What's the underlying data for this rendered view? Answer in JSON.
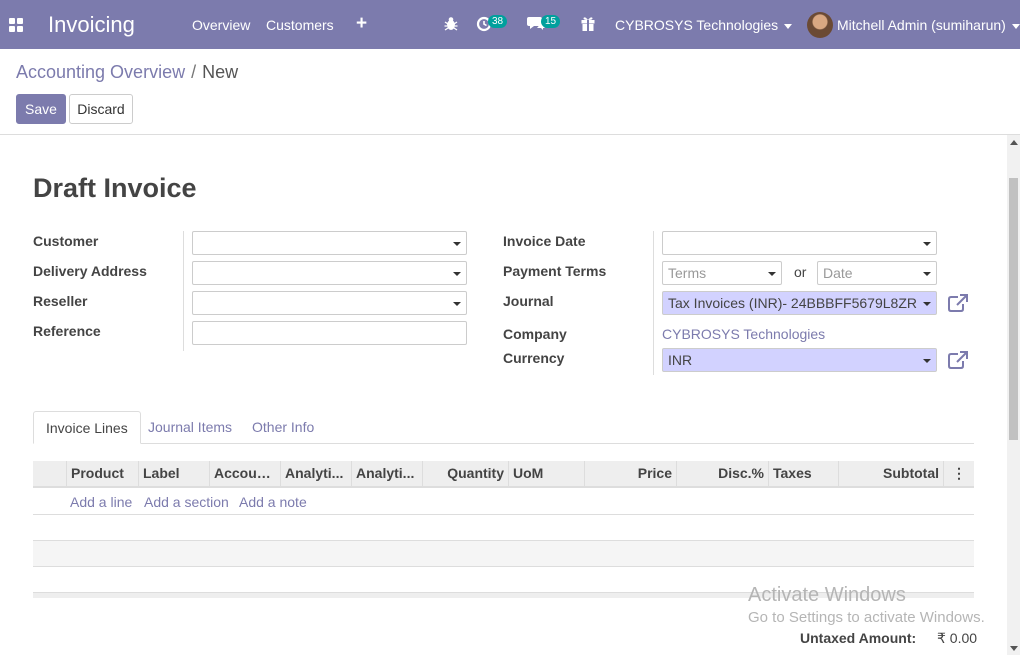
{
  "navbar": {
    "app_title": "Invoicing",
    "menu": [
      "Overview",
      "Customers"
    ],
    "plus": "+",
    "activity_count": "38",
    "messages_count": "15",
    "company": "CYBROSYS Technologies",
    "user": "Mitchell Admin (sumiharun)"
  },
  "breadcrumb": {
    "parent": "Accounting Overview",
    "separator": "/",
    "current": "New"
  },
  "buttons": {
    "save": "Save",
    "discard": "Discard"
  },
  "form": {
    "title": "Draft Invoice",
    "left_labels": [
      "Customer",
      "Delivery Address",
      "Reseller",
      "Reference"
    ],
    "right_labels": {
      "invoice_date": "Invoice Date",
      "payment_terms": "Payment Terms",
      "journal": "Journal",
      "company": "Company",
      "currency": "Currency"
    },
    "terms_placeholder": "Terms",
    "or": "or",
    "date_placeholder": "Date",
    "journal_value": "Tax Invoices (INR)- 24BBBFF5679L8ZR",
    "company_value": "CYBROSYS Technologies",
    "currency_value": "INR"
  },
  "tabs": [
    "Invoice Lines",
    "Journal Items",
    "Other Info"
  ],
  "table": {
    "columns": [
      "Product",
      "Label",
      "Accoun...",
      "Analyti...",
      "Analyti...",
      "Quantity",
      "UoM",
      "Price",
      "Disc.%",
      "Taxes",
      "Subtotal"
    ],
    "options_icon": "⋮",
    "add_line": "Add a line",
    "add_section": "Add a section",
    "add_note": "Add a note"
  },
  "watermark": {
    "line1": "Activate Windows",
    "line2": "Go to Settings to activate Windows."
  },
  "totals": {
    "untaxed_label": "Untaxed Amount:",
    "untaxed_value": "₹ 0.00"
  },
  "colors": {
    "brand": "#7c7bad",
    "badge": "#00a09d",
    "required_field": "#d2d2ff"
  }
}
